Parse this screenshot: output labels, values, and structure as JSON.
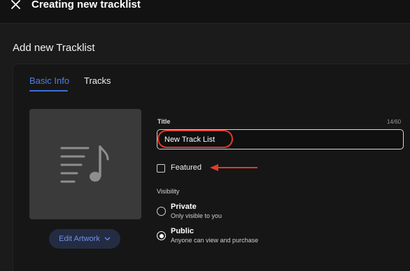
{
  "header": {
    "close_icon": "close-icon",
    "title": "Creating new tracklist"
  },
  "page": {
    "heading": "Add new Tracklist"
  },
  "tabs": [
    {
      "label": "Basic Info",
      "active": true
    },
    {
      "label": "Tracks",
      "active": false
    }
  ],
  "artwork": {
    "placeholder_icon": "music-list-icon",
    "edit_label": "Edit Artwork",
    "edit_icon": "chevron-down-icon"
  },
  "form": {
    "title_label": "Title",
    "title_count": "14/60",
    "title_value": "New Track List",
    "featured_label": "Featured",
    "featured_checked": false,
    "visibility_label": "Visibility",
    "visibility_options": [
      {
        "title": "Private",
        "description": "Only visible to you",
        "selected": false
      },
      {
        "title": "Public",
        "description": "Anyone can view and purchase",
        "selected": true
      }
    ]
  },
  "annotations": {
    "highlight_color": "#e23a2a",
    "arrow_color": "#e23a2a"
  },
  "colors": {
    "accent": "#4f7fe6",
    "background": "#1b1b1b",
    "card": "#161616"
  }
}
